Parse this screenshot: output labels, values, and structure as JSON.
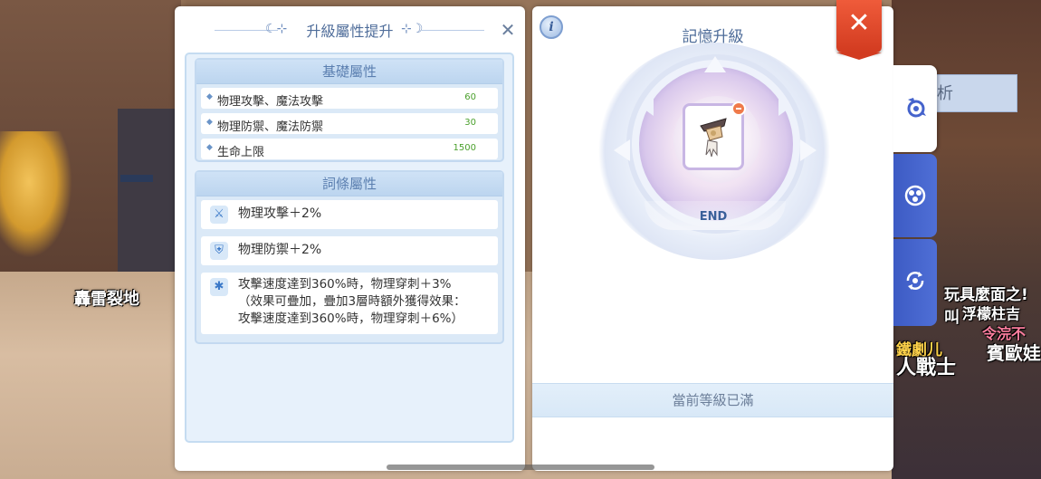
{
  "background": {
    "names": [
      {
        "text": "轟雷裂地",
        "style": "white"
      },
      {
        "text": "玩具麼面之! 叫",
        "style": "white"
      },
      {
        "text": "浮檬柱吉",
        "style": "white"
      },
      {
        "text": "令浣不",
        "style": "pink"
      },
      {
        "text": "賓歐娃",
        "style": "white"
      },
      {
        "text": "鐵劇儿",
        "style": "yellow"
      },
      {
        "text": "人戰士",
        "style": "white"
      }
    ],
    "right_panel_text": "析"
  },
  "left_panel": {
    "title": "升級屬性提升",
    "basic_section": {
      "header": "基礎屬性",
      "rows": [
        {
          "name": "物理攻擊、魔法攻擊",
          "value": "60"
        },
        {
          "name": "物理防禦、魔法防禦",
          "value": "30"
        },
        {
          "name": "生命上限",
          "value": "1500"
        }
      ]
    },
    "trait_section": {
      "header": "詞條屬性",
      "rows": [
        {
          "icon": "sword-icon",
          "text": "物理攻擊＋2%"
        },
        {
          "icon": "shield-icon",
          "text": "物理防禦＋2%"
        },
        {
          "icon": "snowflake-icon",
          "text": "攻擊速度達到360%時，物理穿刺＋3%\n（效果可疊加，疊加3層時額外獲得效果：\n攻擊速度達到360%時，物理穿刺＋6%）"
        }
      ]
    }
  },
  "right_panel": {
    "info_label": "i",
    "title": "記憶升級",
    "item_level": "END",
    "status": "當前等級已滿",
    "close_label": "✕"
  },
  "tabs": [
    {
      "icon": "memory-icon",
      "active": true
    },
    {
      "icon": "orb-icon",
      "active": false
    },
    {
      "icon": "recycle-icon",
      "active": false
    }
  ],
  "colors": {
    "title": "#4f6d9a",
    "value_green": "#4aa02c",
    "close_red": "#e04a2c",
    "tab_blue": "#4563cc"
  }
}
